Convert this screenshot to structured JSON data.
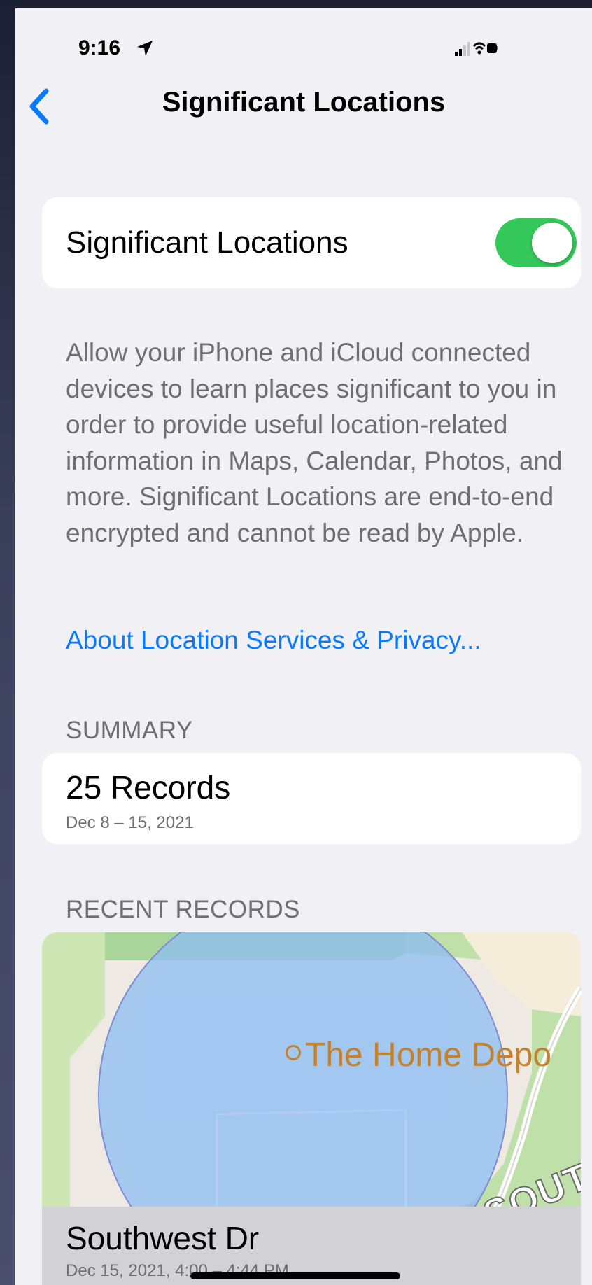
{
  "status_bar": {
    "time": "9:16"
  },
  "nav": {
    "title": "Significant Locations",
    "back_icon": "chevron-left-icon"
  },
  "toggle": {
    "label": "Significant Locations",
    "state": "on",
    "color": "#34c759"
  },
  "description": "Allow your iPhone and iCloud connected devices to learn places significant to you in order to provide useful location-related information in Maps, Calendar, Photos, and more. Significant Locations are end-to-end encrypted and cannot be read by Apple.",
  "about_link": "About Location Services & Privacy...",
  "summary": {
    "header": "SUMMARY",
    "count": "25 Records",
    "date_range": "Dec 8 – 15, 2021"
  },
  "recent": {
    "header": "RECENT RECORDS",
    "map": {
      "poi_label": "The Home Depo",
      "street_label": "SOUT"
    },
    "record": {
      "title": "Southwest Dr",
      "date": "Dec 15, 2021, 4:00 – 4:44 PM"
    }
  },
  "colors": {
    "accent": "#0a7aff",
    "background": "#f1f0f5",
    "secondary_text": "#6e6e73"
  }
}
